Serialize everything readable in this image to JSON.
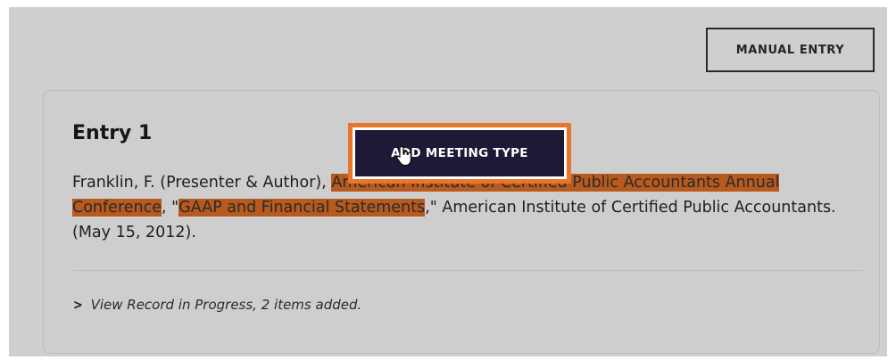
{
  "header": {
    "manual_entry_label": "MANUAL ENTRY"
  },
  "entry": {
    "title": "Entry 1",
    "citation": {
      "prefix": "Franklin, F. (Presenter & Author), ",
      "conference": "American Institute of Certified Public Accountants Annual Conference",
      "mid": ", \"",
      "title": "GAAP and Financial Statements",
      "suffix": ",\" American Institute of Certified Public Accountants. (May 15, 2012)."
    },
    "record_link": "View Record in Progress, 2 items added."
  },
  "tooltip": {
    "label": "ADD MEETING TYPE"
  },
  "icons": {
    "chevron": "chevron-right-icon",
    "cursor": "hand-pointer-icon"
  },
  "colors": {
    "overlay": "#cfcfcf",
    "highlight": "#b85a1e",
    "tooltip_bg": "#1d1936",
    "tooltip_border": "#e8762a"
  }
}
